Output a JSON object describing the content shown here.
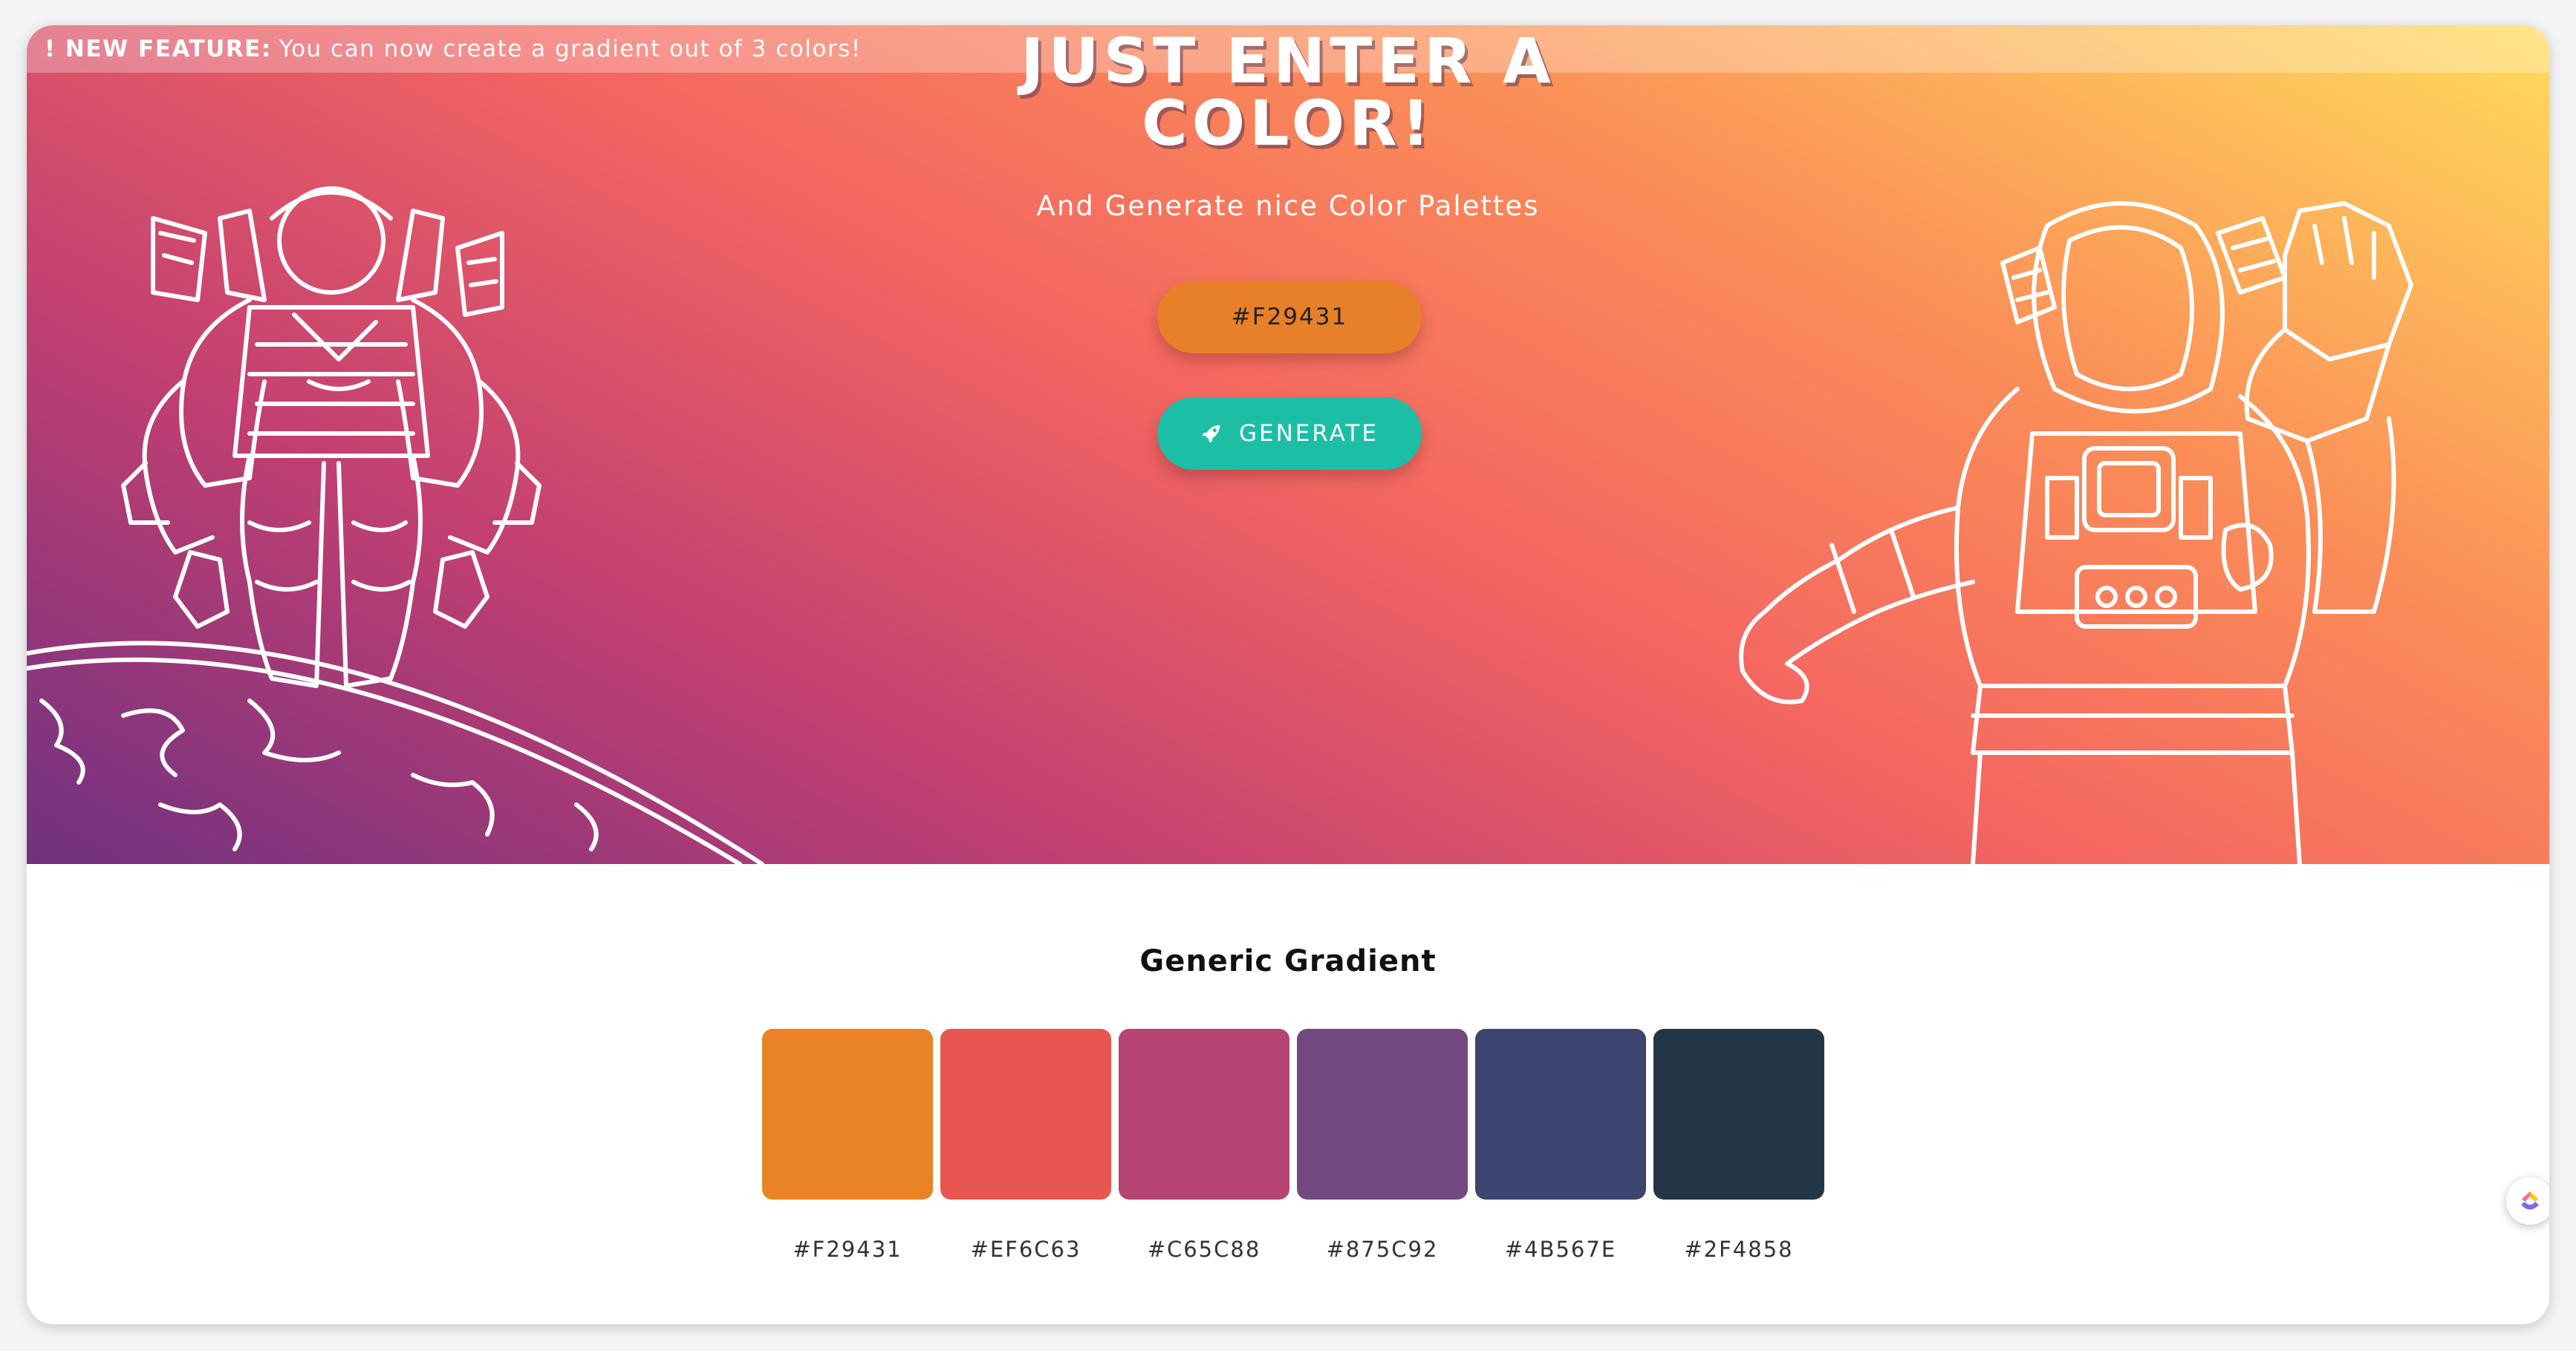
{
  "banner": {
    "tag": "! NEW FEATURE:",
    "text": "You can now create a gradient out of 3 colors!"
  },
  "hero": {
    "title": "JUST ENTER A COLOR!",
    "subtitle": "And Generate nice Color Palettes",
    "input_value": "#F29431",
    "generate_label": "GENERATE",
    "generate_icon": "rocket-icon",
    "gradient_colors": [
      "#6f3180",
      "#c23f72",
      "#f46661",
      "#fb8f58",
      "#ffdc5c"
    ],
    "illustrations": [
      "astronaut-standing-on-planet",
      "astronaut-waving"
    ]
  },
  "palette": {
    "title": "Generic Gradient",
    "swatches": [
      {
        "label": "#F29431",
        "color": "#ea8226"
      },
      {
        "label": "#EF6C63",
        "color": "#e75650"
      },
      {
        "label": "#C65C88",
        "color": "#b54472"
      },
      {
        "label": "#875C92",
        "color": "#744880"
      },
      {
        "label": "#4B567E",
        "color": "#3b456d"
      },
      {
        "label": "#2F4858",
        "color": "#233645"
      }
    ]
  },
  "floating_widget": {
    "icon": "clickup-logo-icon"
  },
  "colors": {
    "input_bg": "#e8802a",
    "button_bg": "#1dbea6"
  }
}
